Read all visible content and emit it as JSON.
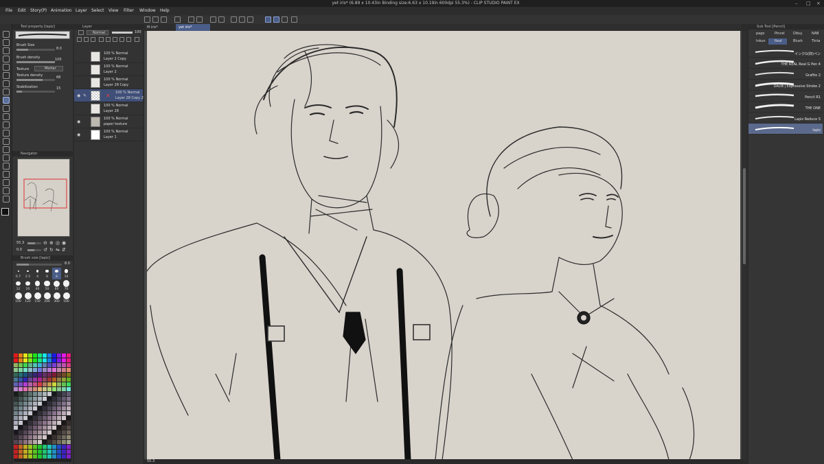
{
  "app": {
    "title": "yet iris* (6.89 x 10.43in Binding size:6.63 x 10.19in 600dpi 55.3%) - CLIP STUDIO PAINT EX"
  },
  "menu": [
    "File",
    "Edit",
    "Story(P)",
    "Animation",
    "Layer",
    "Select",
    "View",
    "Filter",
    "Window",
    "Help"
  ],
  "tool_property": {
    "header": "Tool property [lapiz]",
    "brush_size_label": "Brush Size",
    "brush_size_value": "8.0",
    "brush_density_label": "Brush density",
    "brush_density_value": "100",
    "texture_label": "Texture",
    "texture_value": "Mortar",
    "texture_density_label": "Texture density",
    "texture_density_value": "68",
    "stabilization_label": "Stabilization",
    "stabilization_value": "15"
  },
  "navigator": {
    "header": "Navigator",
    "zoom": "55.3",
    "angle": "0.0"
  },
  "brush_size_panel": {
    "header": "Brush size [lapiz]",
    "value": "8.0",
    "sizes": [
      "0.7",
      "2.5",
      "4",
      "6",
      "8",
      "10",
      "12",
      "20",
      "40",
      "50",
      "60",
      "70",
      "100",
      "120",
      "150",
      "200",
      "300",
      "500"
    ]
  },
  "layer_panel": {
    "header": "Layer",
    "blend_mode": "Normal",
    "opacity": "100",
    "layers": [
      {
        "mode": "100 % Normal",
        "name": "Layer 2 Copy"
      },
      {
        "mode": "100 % Normal",
        "name": "Layer 2"
      },
      {
        "mode": "100 % Normal",
        "name": "Layer 28 Copy"
      },
      {
        "mode": "100 % Normal",
        "name": "Layer 28 Copy 2"
      },
      {
        "mode": "100 % Normal",
        "name": "Layer 28"
      },
      {
        "mode": "100 % Normal",
        "name": "paper texture"
      },
      {
        "mode": "100 % Normal",
        "name": "Layer 1"
      }
    ]
  },
  "tabs": [
    {
      "label": "M iris*"
    },
    {
      "label": "yet iris*"
    }
  ],
  "status": {
    "zoom": "55.3"
  },
  "subtool": {
    "header": "Sub Tool [Pencil]",
    "tabs": [
      "pago",
      "Pincel",
      "Dibuj",
      "NAB",
      "Inkun",
      "Real",
      "Blush",
      "Tinta"
    ],
    "brushes": [
      "インクG(抑)ペン",
      "THE REAL Real G Pen 4",
      "Grafito 2",
      "DAUB | Expressive Stroke 2",
      "Pencil R1",
      "THE ONE",
      "Lapiz Reduce 5",
      "lapiz"
    ]
  },
  "colors": {
    "accent": "#4a5d88",
    "paper": "#d8d3cb",
    "bg": "#2b2b2b"
  }
}
